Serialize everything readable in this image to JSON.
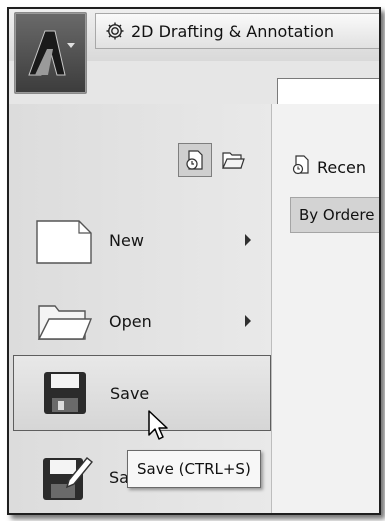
{
  "workspace": {
    "label": "2D Drafting & Annotation"
  },
  "app_menu": {
    "icon": "autocad-logo-icon",
    "view_toggle": [
      "recent-documents-icon",
      "open-documents-icon"
    ],
    "items": [
      {
        "label": "New",
        "icon": "new-document-icon",
        "has_submenu": true
      },
      {
        "label": "Open",
        "icon": "folder-open-icon",
        "has_submenu": true
      },
      {
        "label": "Save",
        "icon": "save-disk-icon",
        "has_submenu": false,
        "hovered": true
      },
      {
        "label": "Save As",
        "icon": "save-as-icon",
        "has_submenu": true
      }
    ]
  },
  "recent_panel": {
    "header": "Recen",
    "sort_label": "By Ordere"
  },
  "tooltip": {
    "text": "Save (CTRL+S)"
  }
}
